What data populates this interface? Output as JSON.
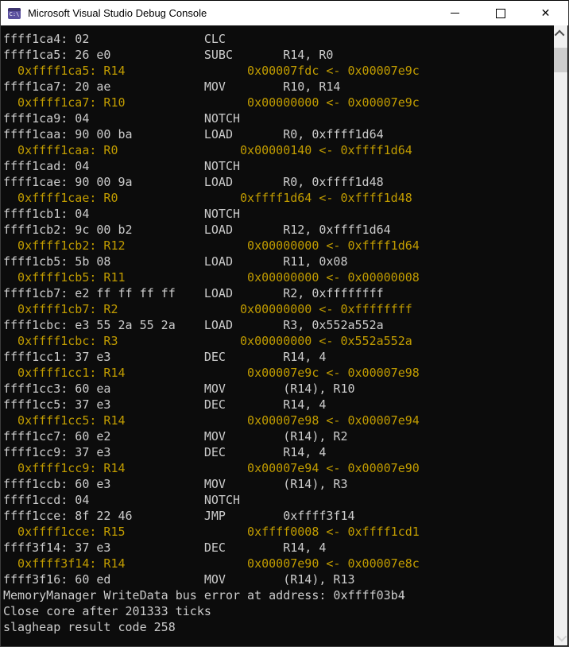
{
  "window": {
    "title": "Microsoft Visual Studio Debug Console",
    "icon_label": "C:\\",
    "close_glyph": "✕"
  },
  "colors": {
    "titlebar_bg": "#ffffff",
    "title_text": "#000000",
    "icon_purple": "#5a4f9e",
    "console_bg": "#0c0c0c",
    "text_default": "#cccccc",
    "text_register_update": "#c19c00",
    "scrollbar_track": "#f0f0f0",
    "scrollbar_thumb": "#cdcdcd"
  },
  "console": {
    "arrow": "<-",
    "lines": [
      {
        "type": "instr",
        "addr": "ffff1ca4",
        "bytes": "02",
        "mnemonic": "CLC",
        "operands": ""
      },
      {
        "type": "instr",
        "addr": "ffff1ca5",
        "bytes": "26 e0",
        "mnemonic": "SUBC",
        "operands": "R14, R0"
      },
      {
        "type": "reg",
        "addr": "0xffff1ca5",
        "reg": "R14",
        "new_val": "0x00007fdc",
        "old_val": "0x00007e9c"
      },
      {
        "type": "instr",
        "addr": "ffff1ca7",
        "bytes": "20 ae",
        "mnemonic": "MOV",
        "operands": "R10, R14"
      },
      {
        "type": "reg",
        "addr": "0xffff1ca7",
        "reg": "R10",
        "new_val": "0x00000000",
        "old_val": "0x00007e9c"
      },
      {
        "type": "instr",
        "addr": "ffff1ca9",
        "bytes": "04",
        "mnemonic": "NOTCH",
        "operands": ""
      },
      {
        "type": "instr",
        "addr": "ffff1caa",
        "bytes": "90 00 ba",
        "mnemonic": "LOAD",
        "operands": "R0, 0xffff1d64"
      },
      {
        "type": "reg",
        "addr": "0xffff1caa",
        "reg": "R0",
        "new_val": "0x00000140",
        "old_val": "0xffff1d64"
      },
      {
        "type": "instr",
        "addr": "ffff1cad",
        "bytes": "04",
        "mnemonic": "NOTCH",
        "operands": ""
      },
      {
        "type": "instr",
        "addr": "ffff1cae",
        "bytes": "90 00 9a",
        "mnemonic": "LOAD",
        "operands": "R0, 0xffff1d48"
      },
      {
        "type": "reg",
        "addr": "0xffff1cae",
        "reg": "R0",
        "new_val": "0xffff1d64",
        "old_val": "0xffff1d48"
      },
      {
        "type": "instr",
        "addr": "ffff1cb1",
        "bytes": "04",
        "mnemonic": "NOTCH",
        "operands": ""
      },
      {
        "type": "instr",
        "addr": "ffff1cb2",
        "bytes": "9c 00 b2",
        "mnemonic": "LOAD",
        "operands": "R12, 0xffff1d64"
      },
      {
        "type": "reg",
        "addr": "0xffff1cb2",
        "reg": "R12",
        "new_val": "0x00000000",
        "old_val": "0xffff1d64"
      },
      {
        "type": "instr",
        "addr": "ffff1cb5",
        "bytes": "5b 08",
        "mnemonic": "LOAD",
        "operands": "R11, 0x08"
      },
      {
        "type": "reg",
        "addr": "0xffff1cb5",
        "reg": "R11",
        "new_val": "0x00000000",
        "old_val": "0x00000008"
      },
      {
        "type": "instr",
        "addr": "ffff1cb7",
        "bytes": "e2 ff ff ff ff",
        "mnemonic": "LOAD",
        "operands": "R2, 0xffffffff"
      },
      {
        "type": "reg",
        "addr": "0xffff1cb7",
        "reg": "R2",
        "new_val": "0x00000000",
        "old_val": "0xffffffff"
      },
      {
        "type": "instr",
        "addr": "ffff1cbc",
        "bytes": "e3 55 2a 55 2a",
        "mnemonic": "LOAD",
        "operands": "R3, 0x552a552a"
      },
      {
        "type": "reg",
        "addr": "0xffff1cbc",
        "reg": "R3",
        "new_val": "0x00000000",
        "old_val": "0x552a552a"
      },
      {
        "type": "instr",
        "addr": "ffff1cc1",
        "bytes": "37 e3",
        "mnemonic": "DEC",
        "operands": "R14, 4"
      },
      {
        "type": "reg",
        "addr": "0xffff1cc1",
        "reg": "R14",
        "new_val": "0x00007e9c",
        "old_val": "0x00007e98"
      },
      {
        "type": "instr",
        "addr": "ffff1cc3",
        "bytes": "60 ea",
        "mnemonic": "MOV",
        "operands": "(R14), R10"
      },
      {
        "type": "instr",
        "addr": "ffff1cc5",
        "bytes": "37 e3",
        "mnemonic": "DEC",
        "operands": "R14, 4"
      },
      {
        "type": "reg",
        "addr": "0xffff1cc5",
        "reg": "R14",
        "new_val": "0x00007e98",
        "old_val": "0x00007e94"
      },
      {
        "type": "instr",
        "addr": "ffff1cc7",
        "bytes": "60 e2",
        "mnemonic": "MOV",
        "operands": "(R14), R2"
      },
      {
        "type": "instr",
        "addr": "ffff1cc9",
        "bytes": "37 e3",
        "mnemonic": "DEC",
        "operands": "R14, 4"
      },
      {
        "type": "reg",
        "addr": "0xffff1cc9",
        "reg": "R14",
        "new_val": "0x00007e94",
        "old_val": "0x00007e90"
      },
      {
        "type": "instr",
        "addr": "ffff1ccb",
        "bytes": "60 e3",
        "mnemonic": "MOV",
        "operands": "(R14), R3"
      },
      {
        "type": "instr",
        "addr": "ffff1ccd",
        "bytes": "04",
        "mnemonic": "NOTCH",
        "operands": ""
      },
      {
        "type": "instr",
        "addr": "ffff1cce",
        "bytes": "8f 22 46",
        "mnemonic": "JMP",
        "operands": "0xffff3f14"
      },
      {
        "type": "reg",
        "addr": "0xffff1cce",
        "reg": "R15",
        "new_val": "0xffff0008",
        "old_val": "0xffff1cd1"
      },
      {
        "type": "instr",
        "addr": "ffff3f14",
        "bytes": "37 e3",
        "mnemonic": "DEC",
        "operands": "R14, 4"
      },
      {
        "type": "reg",
        "addr": "0xffff3f14",
        "reg": "R14",
        "new_val": "0x00007e90",
        "old_val": "0x00007e8c"
      },
      {
        "type": "instr",
        "addr": "ffff3f16",
        "bytes": "60 ed",
        "mnemonic": "MOV",
        "operands": "(R14), R13"
      },
      {
        "type": "plain",
        "text": "MemoryManager WriteData bus error at address: 0xffff03b4"
      },
      {
        "type": "plain",
        "text": "Close core after 201333 ticks"
      },
      {
        "type": "plain",
        "text": "slagheap result code 258"
      }
    ]
  }
}
